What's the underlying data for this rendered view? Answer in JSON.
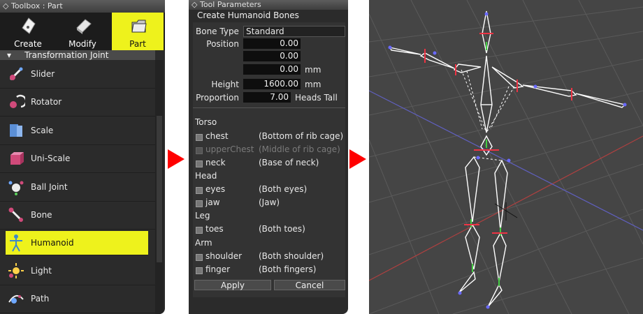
{
  "toolbox": {
    "title": "Toolbox : Part",
    "tabs": [
      {
        "label": "Create",
        "icon": "pen-nib-icon"
      },
      {
        "label": "Modify",
        "icon": "eraser-icon"
      },
      {
        "label": "Part",
        "icon": "folder-icon",
        "active": true
      }
    ],
    "section": "Transformation Joint",
    "items": [
      {
        "label": "Slider",
        "icon": "slider-joint-icon"
      },
      {
        "label": "Rotator",
        "icon": "rotator-joint-icon"
      },
      {
        "label": "Scale",
        "icon": "scale-joint-icon"
      },
      {
        "label": "Uni-Scale",
        "icon": "uni-scale-joint-icon"
      },
      {
        "label": "Ball Joint",
        "icon": "ball-joint-icon"
      },
      {
        "label": "Bone",
        "icon": "bone-icon"
      },
      {
        "label": "Humanoid",
        "icon": "humanoid-icon",
        "selected": true
      },
      {
        "label": "Light",
        "icon": "light-icon"
      },
      {
        "label": "Path",
        "icon": "path-icon"
      }
    ]
  },
  "params": {
    "title": "Tool Parameters",
    "subtitle": "Create Humanoid Bones",
    "bone_type_label": "Bone Type",
    "bone_type_value": "Standard",
    "position_label": "Position",
    "position_x": "0.00",
    "position_y": "0.00",
    "position_z": "0.00",
    "position_unit": "mm",
    "height_label": "Height",
    "height_value": "1600.00",
    "height_unit": "mm",
    "proportion_label": "Proportion",
    "proportion_value": "7.00",
    "proportion_unit": "Heads Tall",
    "groups": {
      "torso": "Torso",
      "head": "Head",
      "leg": "Leg",
      "arm": "Arm"
    },
    "options": {
      "chest": {
        "label": "chest",
        "desc": "(Bottom of rib cage)"
      },
      "upper_chest": {
        "label": "upperChest",
        "desc": "(Middle of rib cage)"
      },
      "neck": {
        "label": "neck",
        "desc": "(Base of neck)"
      },
      "eyes": {
        "label": "eyes",
        "desc": "(Both eyes)"
      },
      "jaw": {
        "label": "jaw",
        "desc": "(Jaw)"
      },
      "toes": {
        "label": "toes",
        "desc": "(Both toes)"
      },
      "shoulder": {
        "label": "shoulder",
        "desc": "(Both shoulder)"
      },
      "finger": {
        "label": "finger",
        "desc": "(Both fingers)"
      }
    },
    "apply_label": "Apply",
    "cancel_label": "Cancel"
  },
  "colors": {
    "accent_yellow": "#eef21c",
    "arrow_red": "#ff0000",
    "panel_bg": "#2b2b2b",
    "viewport_bg": "#454545"
  }
}
